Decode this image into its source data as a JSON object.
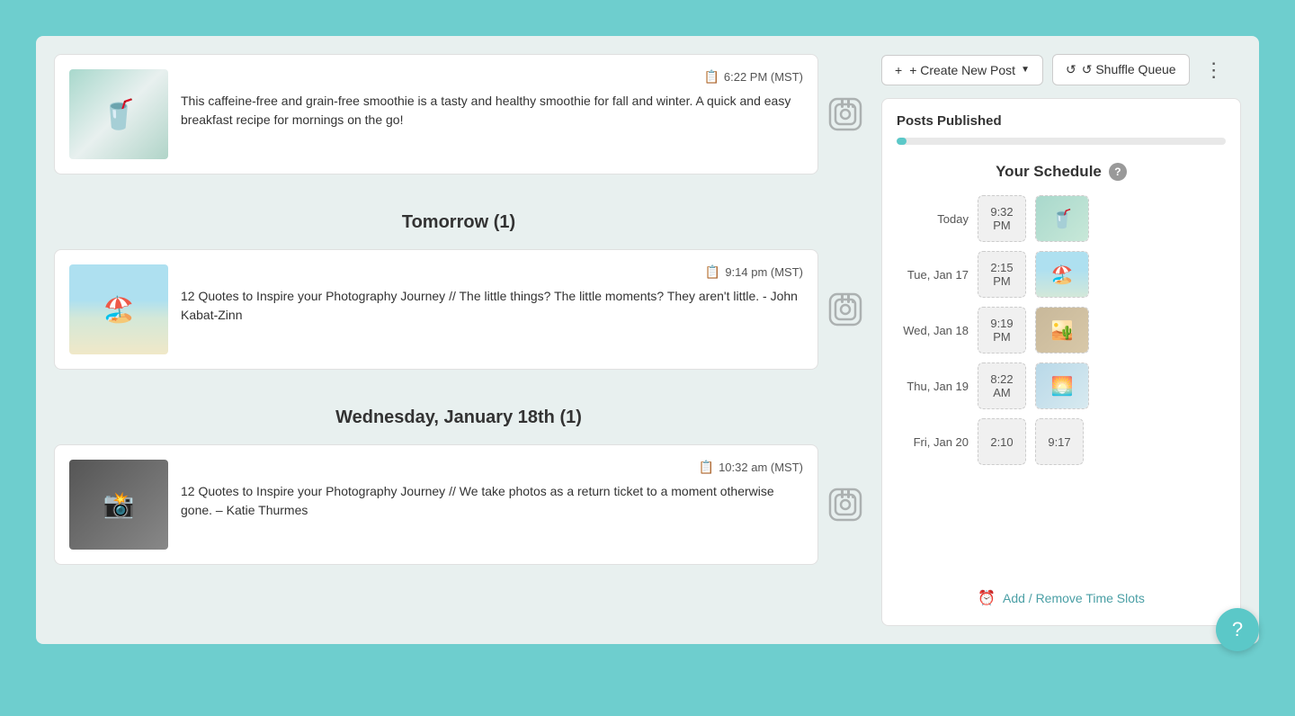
{
  "toolbar": {
    "create_label": "+ Create New Post",
    "shuffle_label": "↺  Shuffle Queue",
    "more_label": "⋮"
  },
  "right_panel": {
    "posts_published_label": "Posts Published",
    "progress_percent": 3,
    "schedule_title": "Your Schedule",
    "add_remove_label": "Add / Remove Time Slots",
    "schedule_rows": [
      {
        "date": "Today",
        "time": "9:32\nPM",
        "thumb_type": "smoothie"
      },
      {
        "date": "Tue, Jan 17",
        "time": "2:15\nPM",
        "thumb_type": "beach"
      },
      {
        "date": "Wed, Jan 18",
        "time": "9:19\nPM",
        "thumb_type": "sand"
      },
      {
        "date": "Thu, Jan 19",
        "time": "8:22\nAM",
        "thumb_type": "sky"
      },
      {
        "date": "Fri, Jan 20",
        "time": "2:10",
        "thumb_type": "empty",
        "time2": "9:17"
      }
    ]
  },
  "posts": [
    {
      "time": "6:22 PM (MST)",
      "text": "This caffeine-free and grain-free smoothie is a tasty and healthy smoothie for fall and winter.  A quick and easy breakfast recipe for mornings on the go!",
      "img_type": "smoothie"
    }
  ],
  "sections": [
    {
      "label": "Tomorrow (1)",
      "posts": [
        {
          "time": "9:14 pm (MST)",
          "text": "12 Quotes to Inspire your Photography Journey // The little things? The little moments? They aren't little. - John Kabat-Zinn",
          "img_type": "beach"
        }
      ]
    },
    {
      "label": "Wednesday, January 18th (1)",
      "posts": [
        {
          "time": "10:32 am (MST)",
          "text": "12 Quotes to Inspire your Photography Journey // We take photos as a return ticket to a moment otherwise gone. – Katie Thurmes",
          "img_type": "dark"
        }
      ]
    }
  ],
  "fab": {
    "label": "?"
  }
}
